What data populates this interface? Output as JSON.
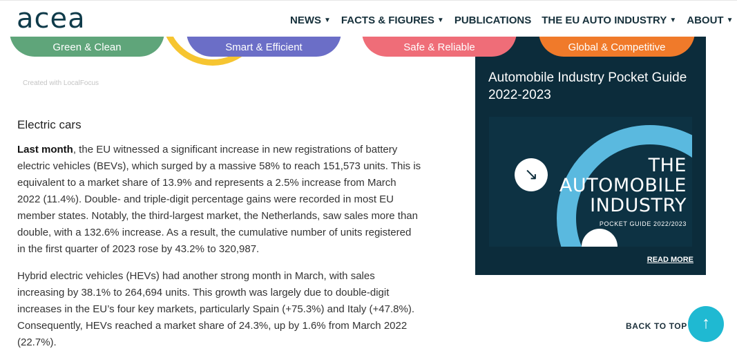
{
  "header": {
    "logo": "acea",
    "nav": [
      {
        "label": "NEWS",
        "dropdown": true
      },
      {
        "label": "FACTS & FIGURES",
        "dropdown": true
      },
      {
        "label": "PUBLICATIONS",
        "dropdown": false
      },
      {
        "label": "THE EU AUTO INDUSTRY",
        "dropdown": true
      },
      {
        "label": "ABOUT",
        "dropdown": true
      }
    ]
  },
  "categories": [
    {
      "label": "Green & Clean",
      "color": "#5fa57a"
    },
    {
      "label": "Smart & Efficient",
      "color": "#6b6ec7"
    },
    {
      "label": "Safe & Reliable",
      "color": "#ef6d78"
    },
    {
      "label": "Global & Competitive",
      "color": "#f07a2a"
    }
  ],
  "credit": "Created with LocalFocus",
  "article": {
    "section_title": "Electric cars",
    "p1_lead": "Last month",
    "p1_rest": ", the EU witnessed a significant increase in new registrations of battery electric vehicles (BEVs), which surged by a massive 58% to reach 151,573 units. This is equivalent to a market share of 13.9% and represents a 2.5% increase from March 2022 (11.4%). Double- and triple-digit percentage gains were recorded in most EU member states. Notably, the third-largest market, the Netherlands, saw sales more than double, with a 132.6% increase. As a result, the cumulative number of units registered in the first quarter of 2023 rose by 43.2% to 320,987.",
    "p2": "Hybrid electric vehicles (HEVs) had another strong month in March, with sales increasing by 38.1% to 264,694 units. This growth was largely due to double-digit increases in the EU’s four key markets, particularly Spain (+75.3%) and Italy (+47.8%). Consequently, HEVs reached a market share of 24.3%, up by 1.6% from March 2022 (22.7%)."
  },
  "promo": {
    "title": "Automobile Industry Pocket Guide 2022-2023",
    "cover_line1": "THE",
    "cover_line2": "AUTOMOBILE",
    "cover_line3": "INDUSTRY",
    "cover_sub": "POCKET GUIDE 2022/2023",
    "read_more": "READ MORE",
    "arrow_icon": "↘"
  },
  "back_to_top": {
    "label": "BACK TO TOP",
    "icon": "↑"
  },
  "colors": {
    "dark_navy": "#0c2c3b",
    "accent_teal": "#1fb9d2",
    "arc_blue": "#5ab9df",
    "yellow": "#f6c531"
  }
}
